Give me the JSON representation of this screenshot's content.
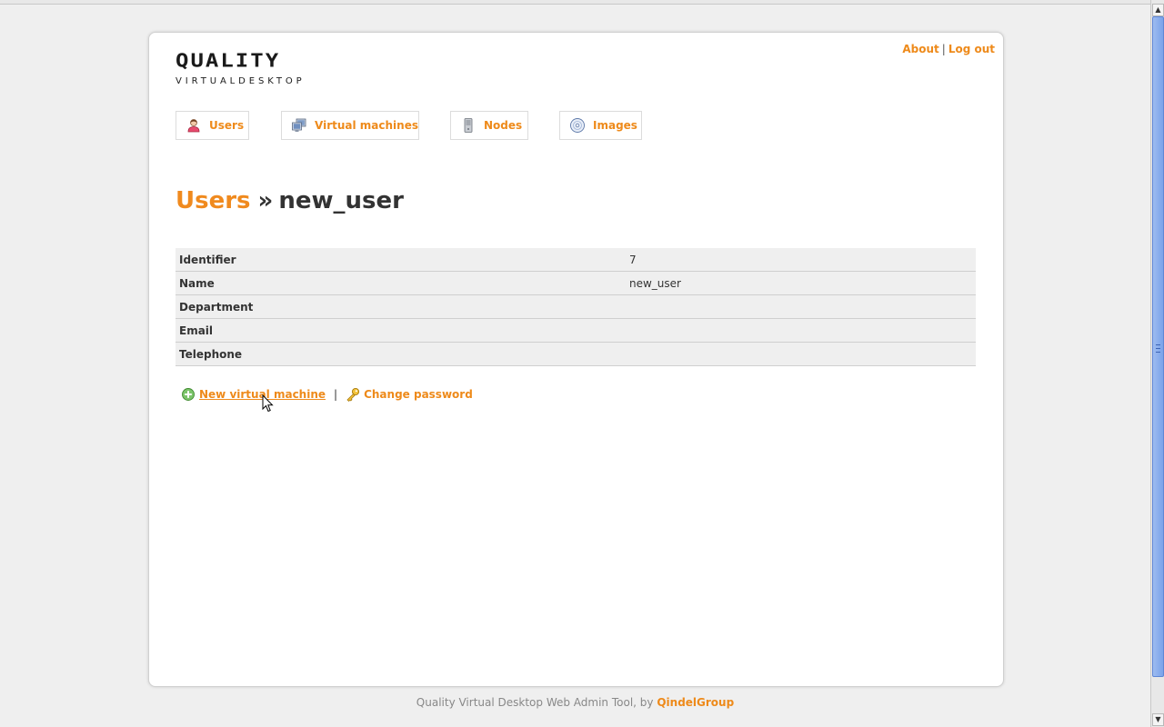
{
  "header": {
    "logo_main": "QUALITY",
    "logo_sub": "VIRTUALDESKTOP",
    "about_label": "About",
    "separator": "|",
    "logout_label": "Log out"
  },
  "nav": {
    "tabs": [
      {
        "label": "Users",
        "icon": "user-icon"
      },
      {
        "label": "Virtual machines",
        "icon": "monitor-icon"
      },
      {
        "label": "Nodes",
        "icon": "server-icon"
      },
      {
        "label": "Images",
        "icon": "disc-icon"
      }
    ]
  },
  "breadcrumb": {
    "parent": "Users",
    "separator": "»",
    "current": "new_user"
  },
  "details": {
    "rows": [
      {
        "label": "Identifier",
        "value": "7"
      },
      {
        "label": "Name",
        "value": "new_user"
      },
      {
        "label": "Department",
        "value": ""
      },
      {
        "label": "Email",
        "value": ""
      },
      {
        "label": "Telephone",
        "value": ""
      }
    ]
  },
  "actions": {
    "new_vm_label": "New virtual machine",
    "separator": "|",
    "change_password_label": "Change password"
  },
  "footer": {
    "text": "Quality Virtual Desktop Web Admin Tool, by",
    "company": "QindelGroup"
  },
  "colors": {
    "accent": "#ee8a1a",
    "background": "#efefef",
    "table_row": "#efefef"
  }
}
